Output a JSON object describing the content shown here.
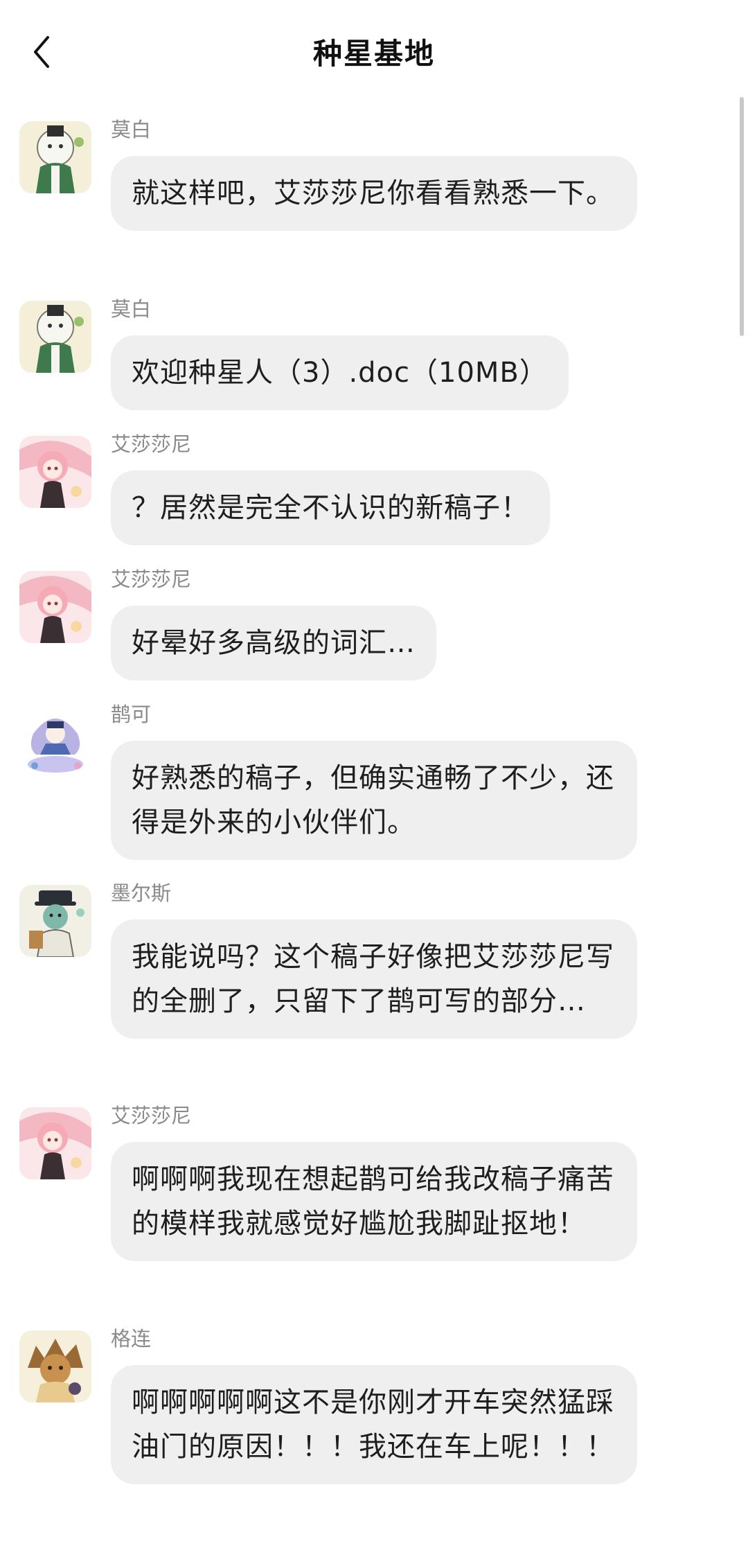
{
  "header": {
    "title": "种星基地"
  },
  "colors": {
    "bubble": "#efefef",
    "sender": "#8a8a8a",
    "background": "#ffffff"
  },
  "messages": [
    {
      "sender": "莫白",
      "avatar": "mobai-avatar",
      "text": "就这样吧，艾莎莎尼你看看熟悉一下。"
    },
    {
      "sender": "莫白",
      "avatar": "mobai-avatar",
      "text": "欢迎种星人（3）.doc（10MB）"
    },
    {
      "sender": "艾莎莎尼",
      "avatar": "aishashani-avatar",
      "text": "？居然是完全不认识的新稿子！"
    },
    {
      "sender": "艾莎莎尼",
      "avatar": "aishashani-avatar",
      "text": "好晕好多高级的词汇…"
    },
    {
      "sender": "鹊可",
      "avatar": "queke-avatar",
      "text": "好熟悉的稿子，但确实通畅了不少，还得是外来的小伙伴们。"
    },
    {
      "sender": "墨尔斯",
      "avatar": "moersi-avatar",
      "text": "我能说吗？这个稿子好像把艾莎莎尼写的全删了，只留下了鹊可写的部分…"
    },
    {
      "sender": "艾莎莎尼",
      "avatar": "aishashani-avatar",
      "text": "啊啊啊我现在想起鹊可给我改稿子痛苦的模样我就感觉好尴尬我脚趾抠地！"
    },
    {
      "sender": "格连",
      "avatar": "gelian-avatar",
      "text": "啊啊啊啊啊这不是你刚才开车突然猛踩油门的原因！！！我还在车上呢！！！"
    }
  ]
}
